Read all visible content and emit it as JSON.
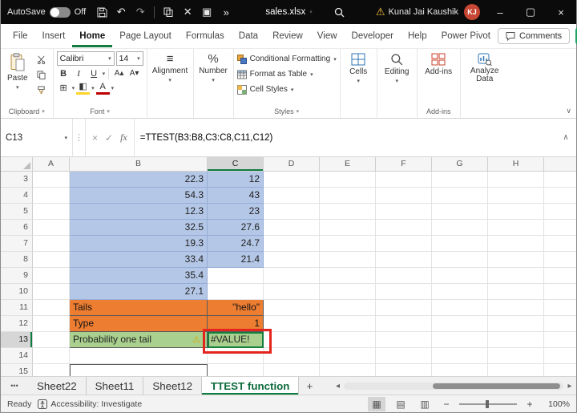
{
  "colors": {
    "excel_green": "#107c41",
    "titlebar_bg": "#0b0b0b",
    "blue_cell": "#b4c7e7",
    "orange_cell": "#ed7d31",
    "green_cell": "#a9d08e",
    "annotation_red": "#e5241d",
    "avatar_bg": "#c74634"
  },
  "titlebar": {
    "autosave_label": "AutoSave",
    "autosave_state": "Off",
    "filename": "sales.xlsx",
    "user_name": "Kunal Jai Kaushik",
    "user_initials": "KJ"
  },
  "ribbon_tabs": [
    "File",
    "Insert",
    "Home",
    "Page Layout",
    "Formulas",
    "Data",
    "Review",
    "View",
    "Developer",
    "Help",
    "Power Pivot"
  ],
  "active_tab": "Home",
  "comments_label": "Comments",
  "ribbon": {
    "paste_label": "Paste",
    "clipboard_group_label": "Clipboard",
    "font_name": "Calibri",
    "font_size": "14",
    "font_group_label": "Font",
    "alignment_label": "Alignment",
    "number_label": "Number",
    "conditional_formatting_label": "Conditional Formatting",
    "format_as_table_label": "Format as Table",
    "cell_styles_label": "Cell Styles",
    "styles_group_label": "Styles",
    "cells_label": "Cells",
    "editing_label": "Editing",
    "addins_label": "Add-ins",
    "addins_group_label": "Add-ins",
    "analyze_data_label": "Analyze Data"
  },
  "formula_bar": {
    "name_box": "C13",
    "formula": "=TTEST(B3:B8,C3:C8,C11,C12)"
  },
  "grid": {
    "columns": [
      "A",
      "B",
      "C",
      "D",
      "E",
      "F",
      "G",
      "H"
    ],
    "selected_column": "C",
    "selected_row": "13",
    "active_cell": "C13",
    "rows": [
      {
        "num": "3",
        "b": "22.3",
        "c": "12"
      },
      {
        "num": "4",
        "b": "54.3",
        "c": "43"
      },
      {
        "num": "5",
        "b": "12.3",
        "c": "23"
      },
      {
        "num": "6",
        "b": "32.5",
        "c": "27.6"
      },
      {
        "num": "7",
        "b": "19.3",
        "c": "24.7"
      },
      {
        "num": "8",
        "b": "33.4",
        "c": "21.4"
      },
      {
        "num": "9",
        "b": "35.4",
        "c": ""
      },
      {
        "num": "10",
        "b": "27.1",
        "c": ""
      },
      {
        "num": "11",
        "b": "Tails",
        "c": "\"hello\""
      },
      {
        "num": "12",
        "b": "Type",
        "c": "1"
      },
      {
        "num": "13",
        "b": "Probability one tail",
        "c": "#VALUE!"
      },
      {
        "num": "14",
        "b": "",
        "c": ""
      },
      {
        "num": "15",
        "b": "",
        "c": ""
      }
    ]
  },
  "sheet_tabs": {
    "tabs": [
      "Sheet22",
      "Sheet11",
      "Sheet12",
      "TTEST function"
    ],
    "active": "TTEST function"
  },
  "status_bar": {
    "ready": "Ready",
    "accessibility": "Accessibility: Investigate",
    "zoom_level": "100%"
  },
  "icons": {
    "undo": "↶",
    "redo": "↷",
    "cut": "✕",
    "picture": "▣",
    "overflow": "»",
    "dropdown": "▾",
    "warning": "⚠",
    "minimize": "–",
    "maximize": "▢",
    "close": "×",
    "bold": "B",
    "italic": "I",
    "underline": "U",
    "align_lines": "≡",
    "percent": "%",
    "grow_font": "A▴",
    "shrink_font": "A▾",
    "font_color": "A",
    "fill_color": "◧",
    "borders": "⊞",
    "more_tabs": "•••",
    "add_sheet": "+",
    "scroll_left": "◂",
    "scroll_right": "▸",
    "view_normal": "▦",
    "view_layout": "▤",
    "view_break": "▥",
    "zoom_out": "−",
    "zoom_in": "+",
    "check": "✓",
    "cancel": "×",
    "fx": "fx",
    "splitter": "⋮",
    "collapse_ribbon": "∨",
    "expand_formula": "∧"
  }
}
